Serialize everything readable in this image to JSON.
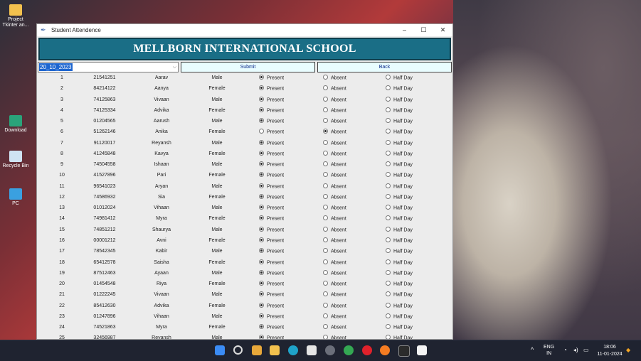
{
  "desktop": {
    "icons": [
      {
        "label": "Project Tkinter an...",
        "icon": "folder-icon"
      },
      {
        "label": "Download",
        "icon": "download-icon"
      },
      {
        "label": "Recycle Bin",
        "icon": "recycle-bin-icon"
      },
      {
        "label": "PC",
        "icon": "pc-icon"
      }
    ]
  },
  "window": {
    "title": "Student Attendence",
    "controls": {
      "minimize": "–",
      "maximize": "☐",
      "close": "✕"
    }
  },
  "header": {
    "school_name": "MELLBORN INTERNATIONAL SCHOOL"
  },
  "toolbar": {
    "date_value": "20_10_2023",
    "submit_label": "Submit",
    "back_label": "Back"
  },
  "options": {
    "present": "Present",
    "absent": "Absent",
    "half_day": "Half Day"
  },
  "students": [
    {
      "sn": "1",
      "id": "21541251",
      "name": "Aarav",
      "gender": "Male",
      "status": "present"
    },
    {
      "sn": "2",
      "id": "84214122",
      "name": "Aanya",
      "gender": "Female",
      "status": "present"
    },
    {
      "sn": "3",
      "id": "74125863",
      "name": "Vivaan",
      "gender": "Male",
      "status": "present"
    },
    {
      "sn": "4",
      "id": "74125334",
      "name": "Advika",
      "gender": "Female",
      "status": "present"
    },
    {
      "sn": "5",
      "id": "01204565",
      "name": "Aarush",
      "gender": "Male",
      "status": "present"
    },
    {
      "sn": "6",
      "id": "51262146",
      "name": "Anika",
      "gender": "Female",
      "status": "absent"
    },
    {
      "sn": "7",
      "id": "91120017",
      "name": "Reyansh",
      "gender": "Male",
      "status": "present"
    },
    {
      "sn": "8",
      "id": "41245848",
      "name": "Kavya",
      "gender": "Female",
      "status": "present"
    },
    {
      "sn": "9",
      "id": "74504558",
      "name": "Ishaan",
      "gender": "Male",
      "status": "present"
    },
    {
      "sn": "10",
      "id": "41527896",
      "name": "Pari",
      "gender": "Female",
      "status": "present"
    },
    {
      "sn": "11",
      "id": "96541023",
      "name": "Aryan",
      "gender": "Male",
      "status": "present"
    },
    {
      "sn": "12",
      "id": "74586932",
      "name": "Sia",
      "gender": "Female",
      "status": "present"
    },
    {
      "sn": "13",
      "id": "01012024",
      "name": "Vihaan",
      "gender": "Male",
      "status": "present"
    },
    {
      "sn": "14",
      "id": "74981412",
      "name": "Myra",
      "gender": "Female",
      "status": "present"
    },
    {
      "sn": "15",
      "id": "74851212",
      "name": "Shaurya",
      "gender": "Male",
      "status": "present"
    },
    {
      "sn": "16",
      "id": "00001212",
      "name": "Avni",
      "gender": "Female",
      "status": "present"
    },
    {
      "sn": "17",
      "id": "78542345",
      "name": "Kabir",
      "gender": "Male",
      "status": "present"
    },
    {
      "sn": "18",
      "id": "65412578",
      "name": "Saisha",
      "gender": "Female",
      "status": "present"
    },
    {
      "sn": "19",
      "id": "87512463",
      "name": "Ayaan",
      "gender": "Male",
      "status": "present"
    },
    {
      "sn": "20",
      "id": "01454548",
      "name": "Riya",
      "gender": "Female",
      "status": "present"
    },
    {
      "sn": "21",
      "id": "01222245",
      "name": "Vivaan",
      "gender": "Male",
      "status": "present"
    },
    {
      "sn": "22",
      "id": "85412630",
      "name": "Advika",
      "gender": "Female",
      "status": "present"
    },
    {
      "sn": "23",
      "id": "01247896",
      "name": "Vihaan",
      "gender": "Male",
      "status": "present"
    },
    {
      "sn": "24",
      "id": "74521863",
      "name": "Myra",
      "gender": "Female",
      "status": "present"
    },
    {
      "sn": "25",
      "id": "32456987",
      "name": "Reyansh",
      "gender": "Male",
      "status": "present"
    }
  ],
  "taskbar": {
    "apps": [
      "windows-start-icon",
      "search-icon",
      "widgets-icon",
      "file-explorer-icon",
      "edge-icon",
      "store-icon",
      "settings-icon",
      "chrome-icon",
      "opera-icon",
      "firefox-icon",
      "terminal-icon",
      "notepad-icon"
    ],
    "language": "ENG",
    "region": "IN",
    "time": "18:06",
    "date": "11-01-2024"
  }
}
